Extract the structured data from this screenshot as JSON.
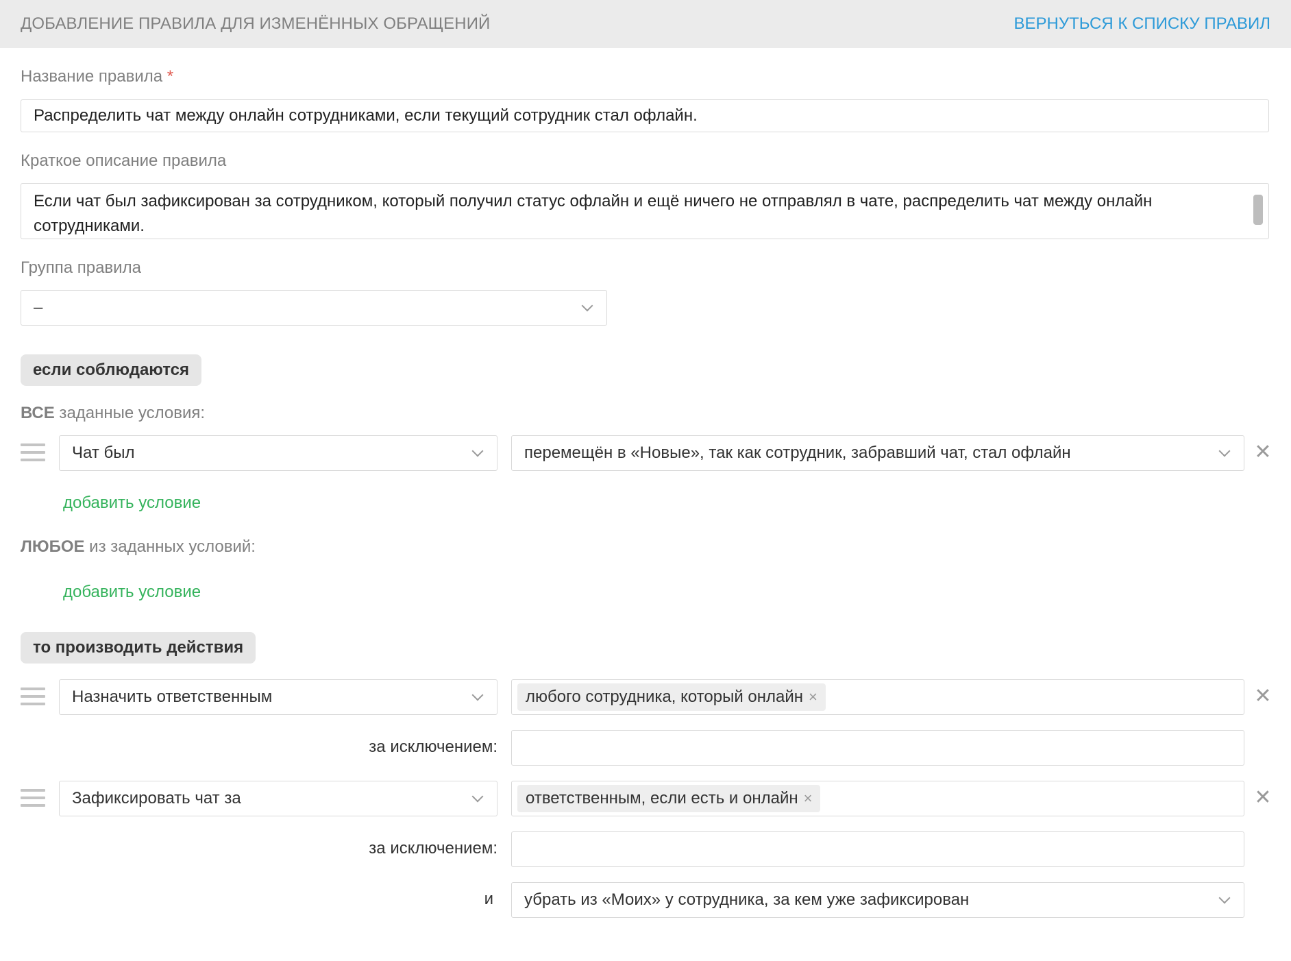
{
  "header": {
    "title": "ДОБАВЛЕНИЕ ПРАВИЛА ДЛЯ ИЗМЕНЁННЫХ ОБРАЩЕНИЙ",
    "back_link": "ВЕРНУТЬСЯ К СПИСКУ ПРАВИЛ"
  },
  "form": {
    "name_label": "Название правила",
    "required_mark": "*",
    "name_value": "Распределить чат между онлайн сотрудниками, если текущий сотрудник стал офлайн.",
    "description_label": "Краткое описание правила",
    "description_value": "Если чат был зафиксирован за сотрудником, который получил статус офлайн и ещё ничего не отправлял в чате, распределить чат между онлайн сотрудниками.",
    "group_label": "Группа правила",
    "group_value": "–"
  },
  "conditions": {
    "section_label": "если соблюдаются",
    "all_bold": "ВСЕ",
    "all_rest": " заданные условия:",
    "all_items": [
      {
        "field": "Чат был",
        "value": "перемещён в «Новые», так как сотрудник, забравший чат, стал офлайн"
      }
    ],
    "add_condition": "добавить условие",
    "any_bold": "ЛЮБОЕ",
    "any_rest": " из заданных условий:"
  },
  "actions": {
    "section_label": "то производить действия",
    "items": [
      {
        "action": "Назначить ответственным",
        "tag": "любого сотрудника, который онлайн",
        "except_label": "за исключением:",
        "except_value": ""
      },
      {
        "action": "Зафиксировать чат за",
        "tag": "ответственным, если есть и онлайн",
        "except_label": "за исключением:",
        "except_value": ""
      }
    ],
    "and_label": "и",
    "and_value": "убрать из «Моих» у сотрудника, за кем уже зафиксирован"
  },
  "icons": {
    "remove": "✕",
    "tag_remove": "×"
  },
  "colors": {
    "link_blue": "#2c9ad8",
    "add_green": "#35b35c",
    "required_red": "#e05a4f",
    "header_bg": "#ebebeb"
  }
}
